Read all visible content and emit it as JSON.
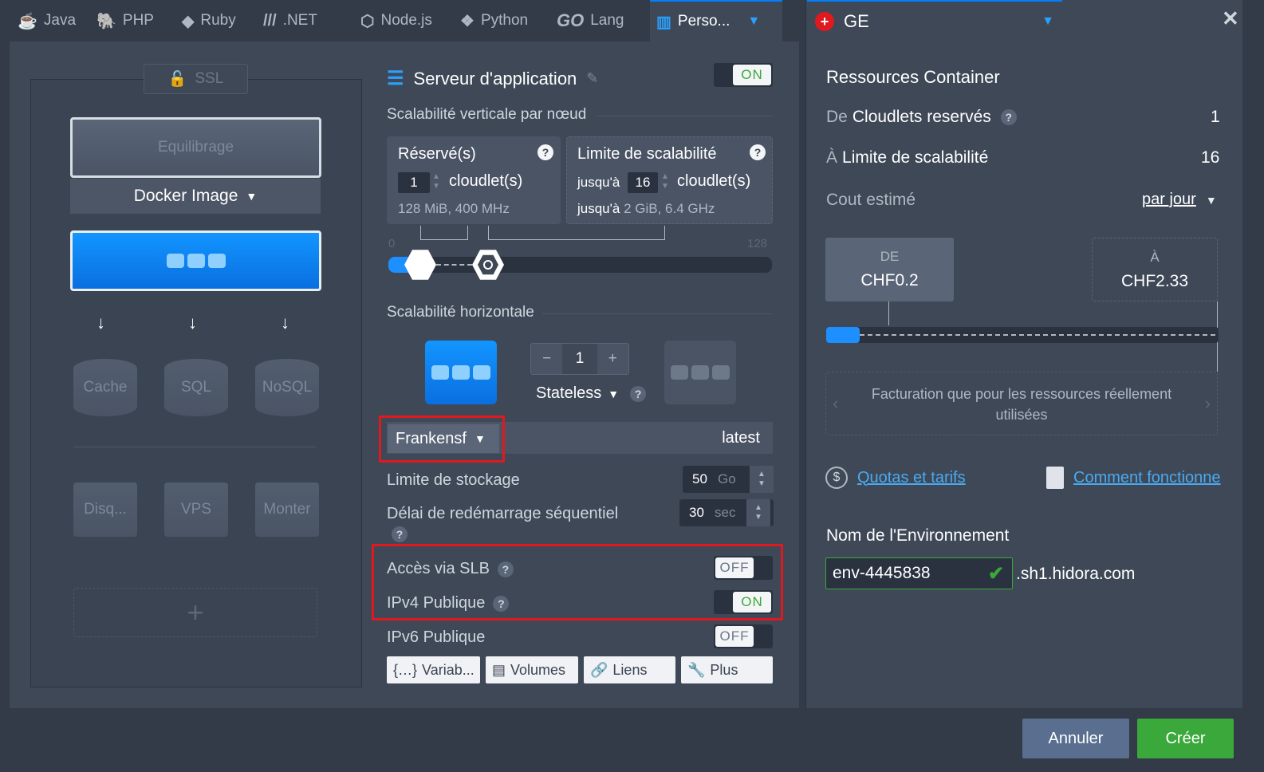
{
  "tabs": [
    {
      "label": "Java",
      "icon": "java-icon"
    },
    {
      "label": "PHP",
      "icon": "php-icon"
    },
    {
      "label": "Ruby",
      "icon": "ruby-icon"
    },
    {
      "label": ".NET",
      "icon": "dotnet-icon"
    },
    {
      "label": "Node.js",
      "icon": "nodejs-icon"
    },
    {
      "label": "Python",
      "icon": "python-icon"
    },
    {
      "label": "Lang",
      "icon": "go-icon",
      "logo_text": "GO"
    },
    {
      "label": "Perso...",
      "icon": "custom-icon"
    }
  ],
  "region": {
    "label": "GE",
    "icon": "swiss-flag-icon"
  },
  "topology": {
    "ssl": "SSL",
    "balancing": "Equilibrage",
    "docker_image": "Docker Image",
    "cache": "Cache",
    "sql": "SQL",
    "nosql": "NoSQL",
    "disk": "Disq...",
    "vps": "VPS",
    "mount": "Monter",
    "add": "+"
  },
  "server": {
    "title": "Serveur d'application",
    "toggle": "ON",
    "vertical_title": "Scalabilité verticale par nœud",
    "reserved_title": "Réservé(s)",
    "reserved_value": "1",
    "cloudlets_unit": "cloudlet(s)",
    "reserved_desc": "128 MiB, 400 MHz",
    "limit_title": "Limite de scalabilité",
    "up_to": "jusqu'à",
    "limit_value": "16",
    "limit_desc_prefix": "jusqu'à",
    "limit_desc": "2 GiB, 6.4 GHz",
    "slider_min": "0",
    "slider_max": "128",
    "reserved_cloudlets": 1,
    "limit_cloudlets": 16,
    "slider_max_value": 128,
    "horizontal_title": "Scalabilité horizontale",
    "node_count": "1",
    "stateless": "Stateless",
    "region_tag": "Frankensf",
    "tag": "latest",
    "storage_label": "Limite de stockage",
    "storage_value": "50",
    "storage_unit": "Go",
    "restart_label": "Délai de redémarrage séquentiel",
    "restart_value": "30",
    "restart_unit": "sec",
    "slb_label": "Accès via SLB",
    "slb_toggle": "OFF",
    "ipv4_label": "IPv4 Publique",
    "ipv4_toggle": "ON",
    "ipv6_label": "IPv6 Publique",
    "ipv6_toggle": "OFF",
    "btn_variables": "Variab...",
    "btn_volumes": "Volumes",
    "btn_links": "Liens",
    "btn_more": "Plus"
  },
  "resources": {
    "title": "Ressources Container",
    "from_prefix": "De",
    "reserved_label": "Cloudlets reservés",
    "reserved_value": "1",
    "to_prefix": "À",
    "limit_label": "Limite de scalabilité",
    "limit_value": "16",
    "cost_label": "Cout estimé",
    "period": "par jour",
    "from_caption": "DE",
    "from_price": "CHF0.2",
    "to_caption": "À",
    "to_price": "CHF2.33",
    "billing_note": "Facturation que pour les ressources réellement utilisées",
    "quotas_link": "Quotas et tarifs",
    "how_link": "Comment fonctionne",
    "env_label": "Nom de l'Environnement",
    "env_value": "env-4445838",
    "env_domain": ".sh1.hidora.com"
  },
  "actions": {
    "cancel": "Annuler",
    "create": "Créer"
  },
  "colors": {
    "accent": "#0080ff",
    "on": "#3aa83a",
    "highlight": "#e0191e",
    "background": "#3e4857"
  }
}
